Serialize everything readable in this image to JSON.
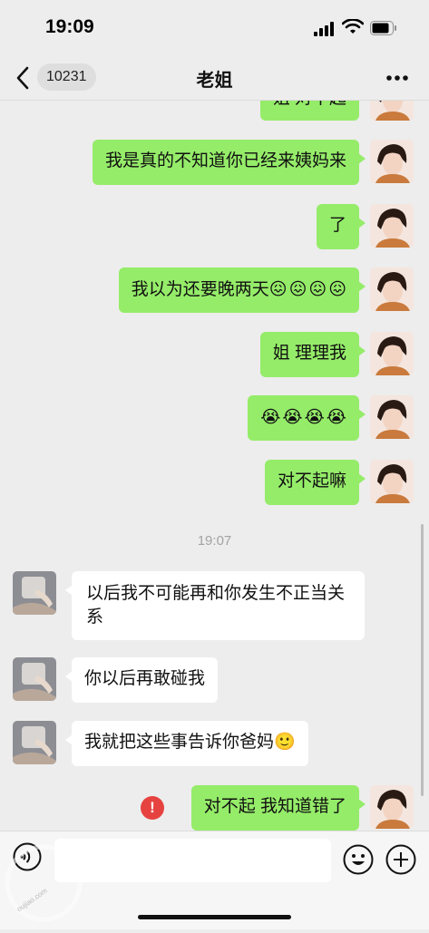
{
  "status": {
    "time": "19:09"
  },
  "nav": {
    "unread_badge": "10231",
    "title": "老姐"
  },
  "messages": [
    {
      "dir": "out",
      "text": "姐 对不起"
    },
    {
      "dir": "out",
      "text": "我是真的不知道你已经来姨妈来"
    },
    {
      "dir": "out",
      "text": "了"
    },
    {
      "dir": "out",
      "text": "我以为还要晚两天",
      "emoji": [
        "😖",
        "😖",
        "😖",
        "😖"
      ]
    },
    {
      "dir": "out",
      "text": "姐 理理我"
    },
    {
      "dir": "out",
      "text": "",
      "emoji": [
        "😭",
        "😭",
        "😭",
        "😭"
      ]
    },
    {
      "dir": "out",
      "text": "对不起嘛"
    },
    {
      "dir": "time",
      "text": "19:07"
    },
    {
      "dir": "in",
      "text": "以后我不可能再和你发生不正当关系"
    },
    {
      "dir": "in",
      "text": "你以后再敢碰我"
    },
    {
      "dir": "in",
      "text": "我就把这些事告诉你爸妈",
      "emoji": [
        "🙂"
      ]
    },
    {
      "dir": "out",
      "text": "对不起 我知道错了",
      "failed": true
    }
  ],
  "input": {
    "placeholder": ""
  },
  "watermark": {
    "text": "oujiao.com"
  },
  "colors": {
    "outgoing_bubble": "#95ec69",
    "incoming_bubble": "#ffffff",
    "error": "#e64340"
  }
}
